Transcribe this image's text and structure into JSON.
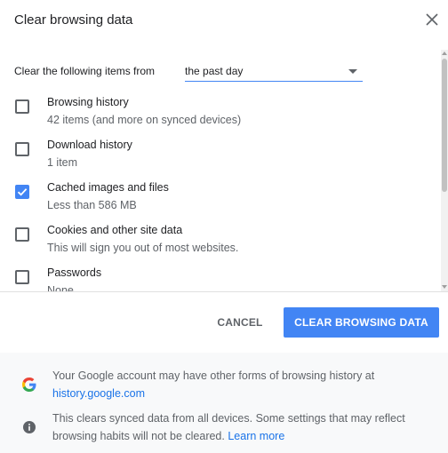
{
  "dialog": {
    "title": "Clear browsing data"
  },
  "time_range": {
    "label": "Clear the following items from",
    "selected": "the past day"
  },
  "items": [
    {
      "title": "Browsing history",
      "subtitle": "42 items (and more on synced devices)",
      "checked": false
    },
    {
      "title": "Download history",
      "subtitle": "1 item",
      "checked": false
    },
    {
      "title": "Cached images and files",
      "subtitle": "Less than 586 MB",
      "checked": true
    },
    {
      "title": "Cookies and other site data",
      "subtitle": "This will sign you out of most websites.",
      "checked": false
    },
    {
      "title": "Passwords",
      "subtitle": "None",
      "checked": false
    }
  ],
  "buttons": {
    "cancel": "CANCEL",
    "clear": "CLEAR BROWSING DATA"
  },
  "footer": {
    "google_text": "Your Google account may have other forms of browsing history at",
    "google_link": "history.google.com",
    "info_text": "This clears synced data from all devices. Some settings that may reflect browsing habits will not be cleared.",
    "info_link": "Learn more"
  },
  "colors": {
    "accent": "#4285f4",
    "link": "#1a73e8",
    "text": "#202124",
    "secondary_text": "#5f6368"
  },
  "icons": {
    "close": "close-icon",
    "dropdown": "chevron-down-icon",
    "checkbox_checked": "checkmark-icon",
    "google": "google-logo-icon",
    "info": "info-icon"
  }
}
